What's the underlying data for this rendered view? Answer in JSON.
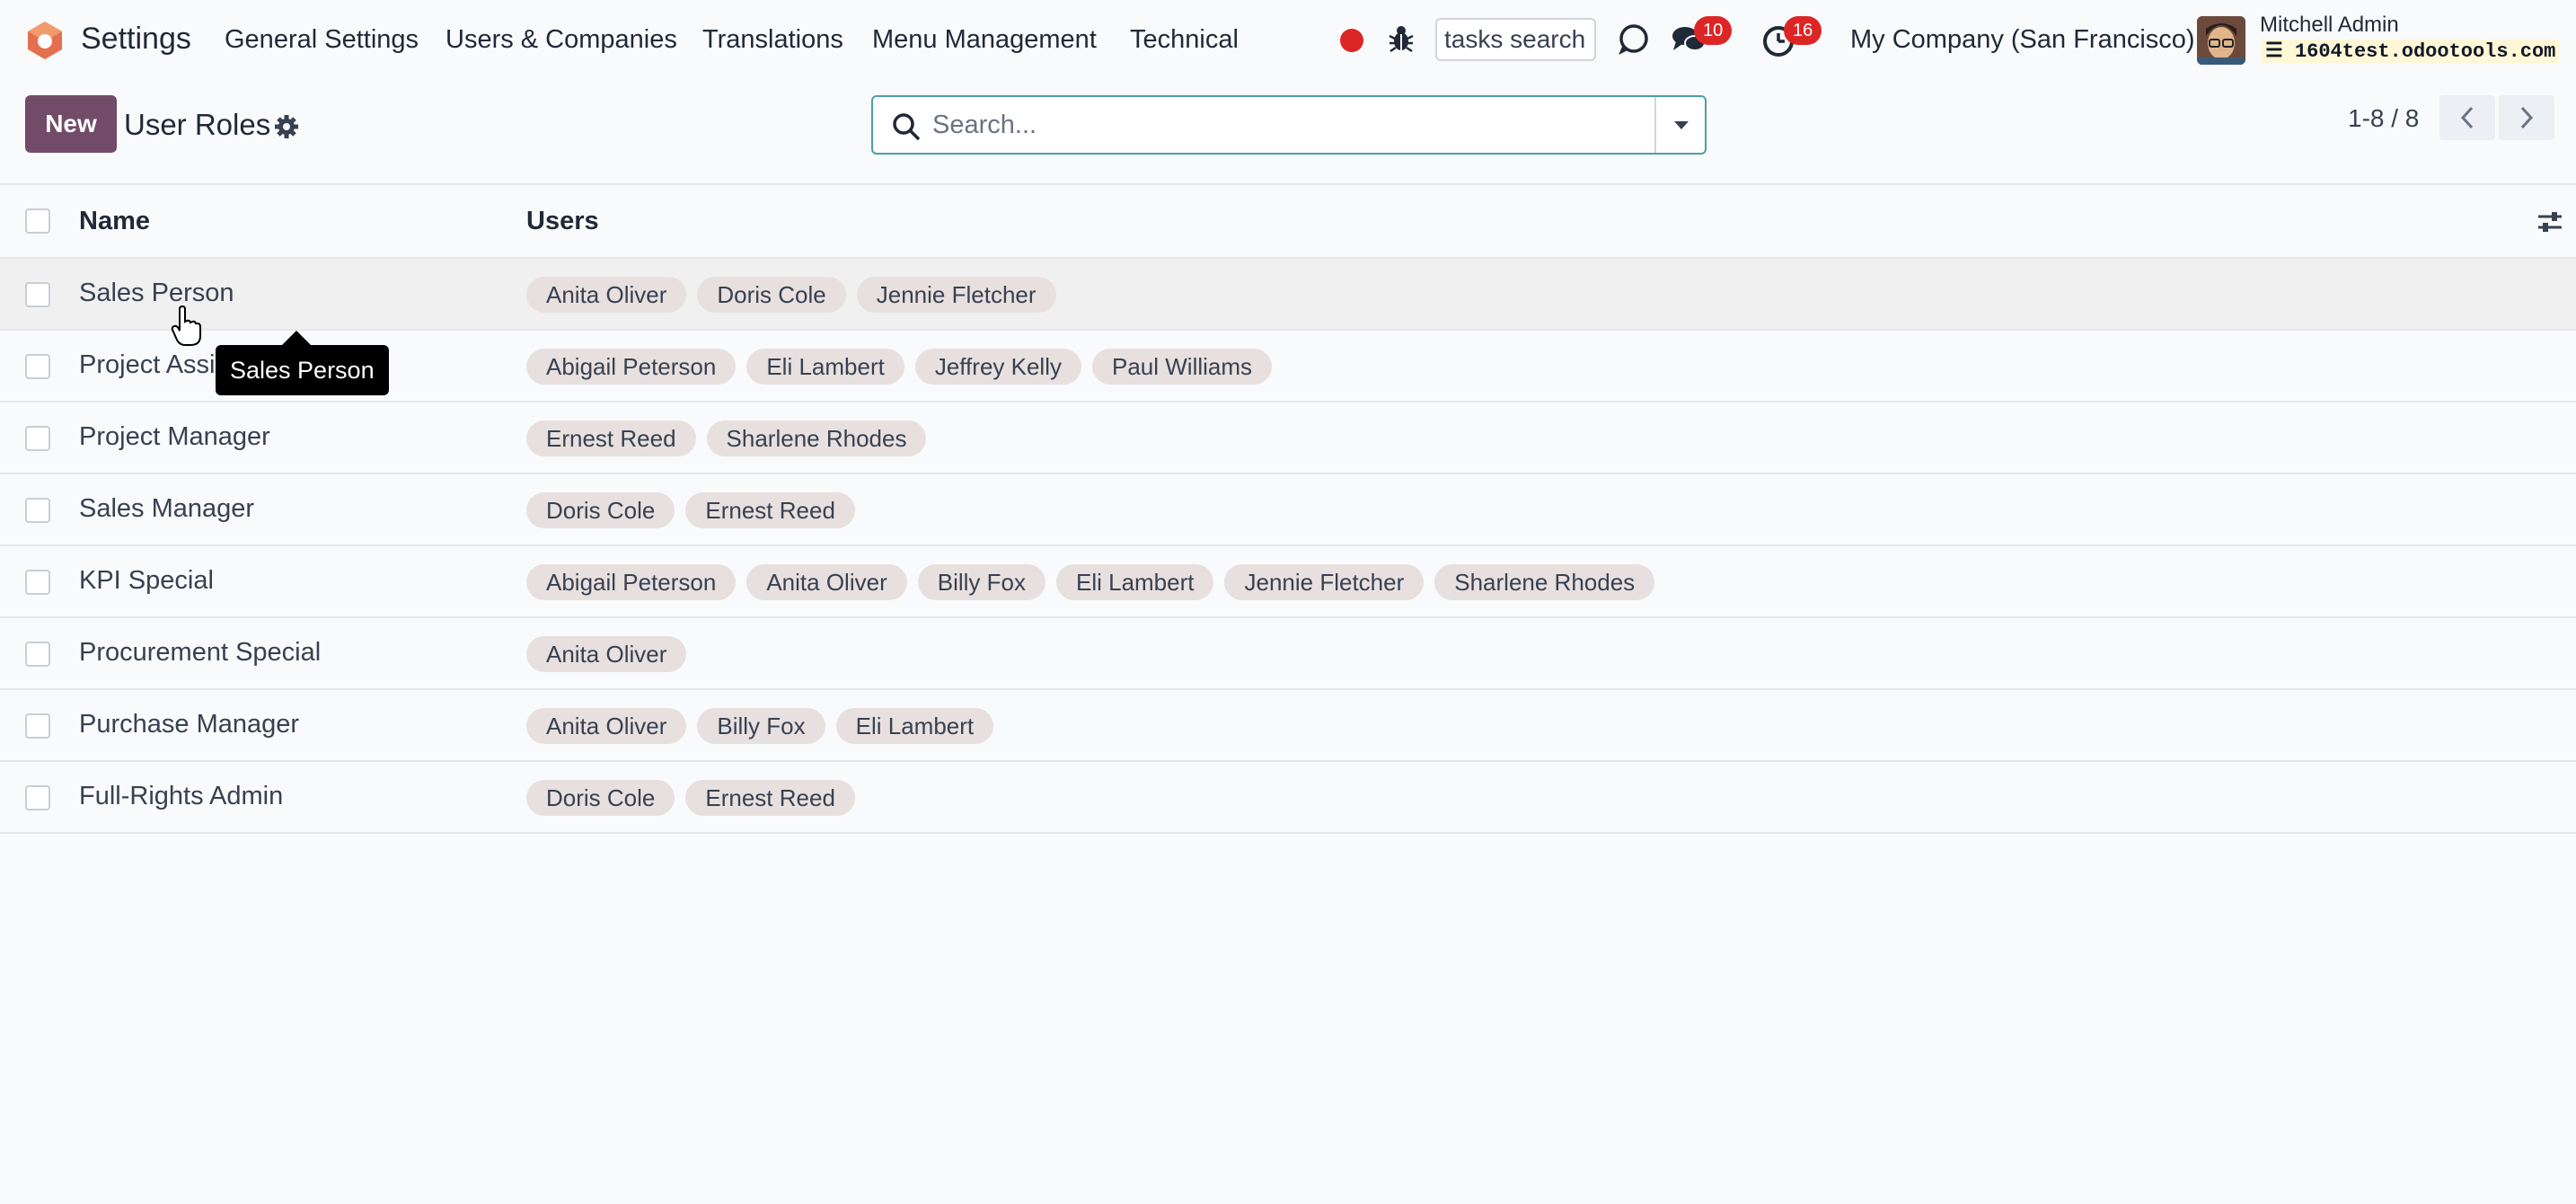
{
  "navbar": {
    "app_name": "Settings",
    "menus": [
      "General Settings",
      "Users & Companies",
      "Translations",
      "Menu Management",
      "Technical"
    ],
    "tasks_search_value": "tasks search",
    "messages_count": "10",
    "activities_count": "16",
    "company": "My Company (San Francisco)",
    "user_name": "Mitchell Admin",
    "database": "1604test.odootools.com",
    "accent_color": "#714b67",
    "badge_color": "#dc2626"
  },
  "control_panel": {
    "new_label": "New",
    "title": "User Roles",
    "search_placeholder": "Search...",
    "pager": "1-8 / 8"
  },
  "list": {
    "columns": [
      "Name",
      "Users"
    ],
    "rows": [
      {
        "name": "Sales Person",
        "users": [
          "Anita Oliver",
          "Doris Cole",
          "Jennie Fletcher"
        ]
      },
      {
        "name": "Project Assistant",
        "users": [
          "Abigail Peterson",
          "Eli Lambert",
          "Jeffrey Kelly",
          "Paul Williams"
        ]
      },
      {
        "name": "Project Manager",
        "users": [
          "Ernest Reed",
          "Sharlene Rhodes"
        ]
      },
      {
        "name": "Sales Manager",
        "users": [
          "Doris Cole",
          "Ernest Reed"
        ]
      },
      {
        "name": "KPI Special",
        "users": [
          "Abigail Peterson",
          "Anita Oliver",
          "Billy Fox",
          "Eli Lambert",
          "Jennie Fletcher",
          "Sharlene Rhodes"
        ]
      },
      {
        "name": "Procurement Special",
        "users": [
          "Anita Oliver"
        ]
      },
      {
        "name": "Purchase Manager",
        "users": [
          "Anita Oliver",
          "Billy Fox",
          "Eli Lambert"
        ]
      },
      {
        "name": "Full-Rights Admin",
        "users": [
          "Doris Cole",
          "Ernest Reed"
        ]
      }
    ]
  },
  "tooltip": {
    "text": "Sales Person"
  }
}
